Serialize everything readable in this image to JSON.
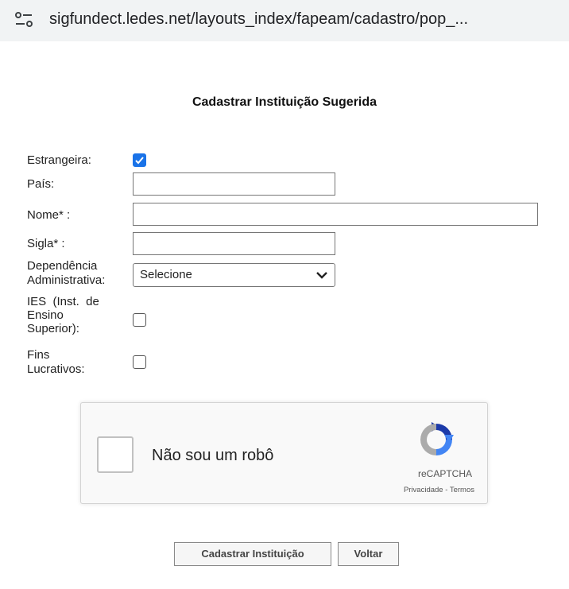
{
  "browser": {
    "url": "sigfundect.ledes.net/layouts_index/fapeam/cadastro/pop_...",
    "site_icon": "site-settings-icon"
  },
  "form": {
    "title": "Cadastrar Instituição Sugerida",
    "fields": {
      "estrangeira": {
        "label": "Estrangeira:",
        "checked": true
      },
      "pais": {
        "label": "País:",
        "value": ""
      },
      "nome": {
        "label": "Nome* :",
        "value": ""
      },
      "sigla": {
        "label": "Sigla* :",
        "value": ""
      },
      "dependencia": {
        "label_line1": "Dependência",
        "label_line2": "Administrativa:",
        "selected": "Selecione"
      },
      "ies": {
        "label_line1": "IES  (Inst.  de",
        "label_line2": "Ensino",
        "label_line3": "Superior):",
        "checked": false
      },
      "fins": {
        "label_line1": "Fins",
        "label_line2": "Lucrativos:",
        "checked": false
      }
    }
  },
  "captcha": {
    "label": "Não sou um robô",
    "brand": "reCAPTCHA",
    "links": "Privacidade - Termos",
    "checked": false
  },
  "buttons": {
    "submit": "Cadastrar Instituição",
    "back": "Voltar"
  },
  "colors": {
    "checkbox_checked": "#1a73e8",
    "url_bar": "#f1f3f4"
  }
}
